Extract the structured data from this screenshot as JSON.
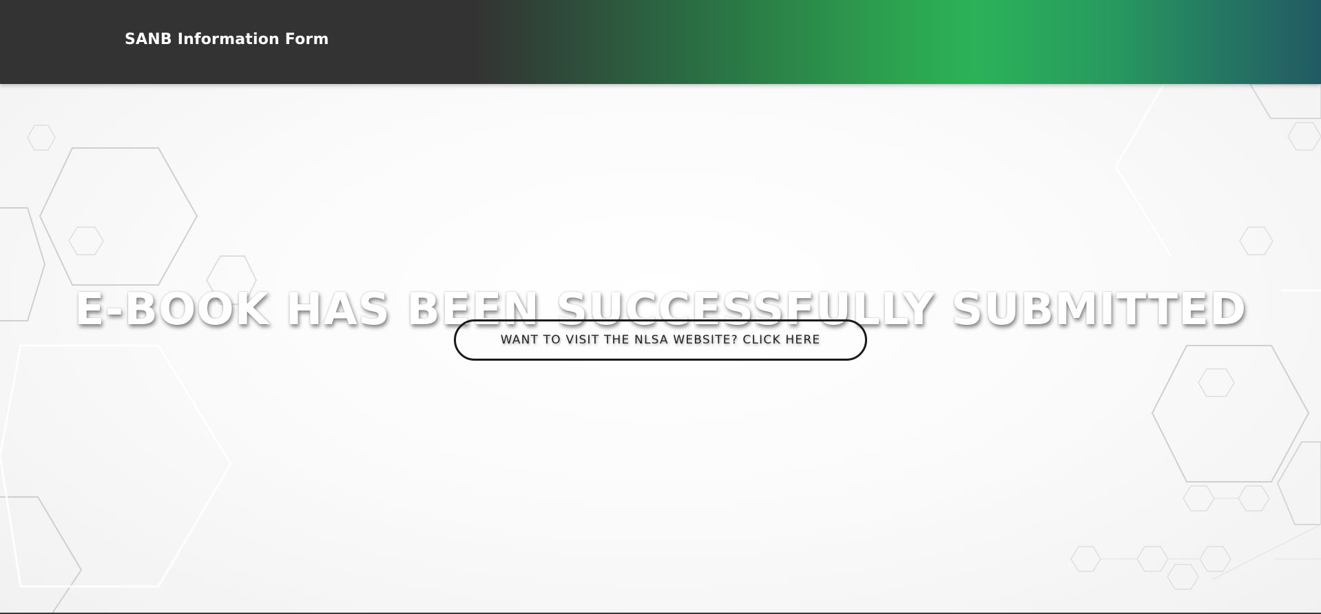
{
  "header": {
    "title": "SANB Information Form"
  },
  "hero": {
    "headline": "E-BOOK HAS BEEN SUCCESSFULLY SUBMITTED",
    "cta_label": "WANT TO VISIT THE NLSA WEBSITE? CLICK HERE"
  },
  "colors": {
    "header_dark": "#333333",
    "header_green": "#2bb259",
    "header_teal": "#225964",
    "button_border": "#1a1a1a"
  }
}
